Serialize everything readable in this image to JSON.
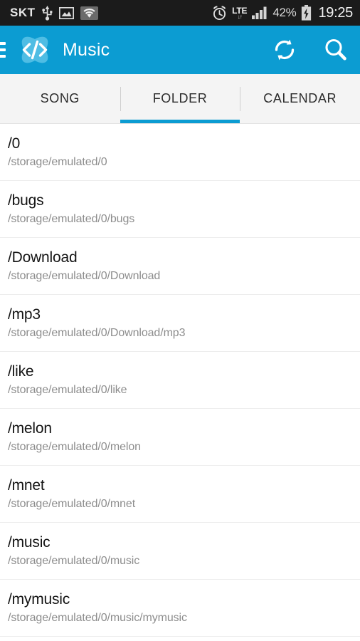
{
  "statusbar": {
    "carrier": "SKT",
    "icons_left": [
      "usb-icon",
      "gallery-icon",
      "wifi-icon"
    ],
    "alarm": "alarm-icon",
    "network_type": "LTE",
    "network_arrows": "↓↑",
    "signal": "signal-bars-icon",
    "battery_percent": "42%",
    "battery": "battery-charging-icon",
    "time": "19:25"
  },
  "appbar": {
    "menu": "hamburger-menu-icon",
    "logo": "code-brackets-logo",
    "logo_glyph": "</>",
    "title": "Music",
    "refresh": "refresh-icon",
    "search": "search-icon",
    "bg_color": "#0c9cd2"
  },
  "tabs": {
    "active_index": 1,
    "items": [
      {
        "label": "SONG"
      },
      {
        "label": "FOLDER"
      },
      {
        "label": "CALENDAR"
      }
    ],
    "indicator_color": "#0c9cd2"
  },
  "folders": [
    {
      "name": "/0",
      "path": "/storage/emulated/0"
    },
    {
      "name": "/bugs",
      "path": "/storage/emulated/0/bugs"
    },
    {
      "name": "/Download",
      "path": "/storage/emulated/0/Download"
    },
    {
      "name": "/mp3",
      "path": "/storage/emulated/0/Download/mp3"
    },
    {
      "name": "/like",
      "path": "/storage/emulated/0/like"
    },
    {
      "name": "/melon",
      "path": "/storage/emulated/0/melon"
    },
    {
      "name": "/mnet",
      "path": "/storage/emulated/0/mnet"
    },
    {
      "name": "/music",
      "path": "/storage/emulated/0/music"
    },
    {
      "name": "/mymusic",
      "path": "/storage/emulated/0/music/mymusic"
    }
  ]
}
